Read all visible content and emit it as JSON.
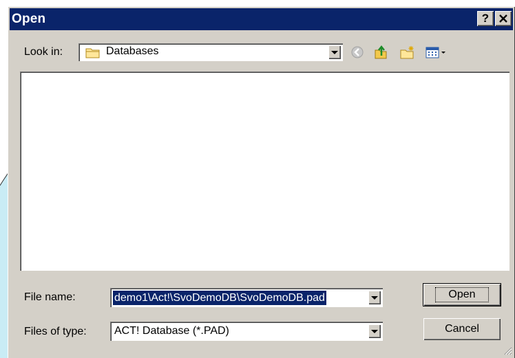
{
  "dialog": {
    "title": "Open",
    "help_button": "?",
    "close_button": "✕"
  },
  "look_in": {
    "label": "Look in:",
    "value": "Databases"
  },
  "toolbar": {
    "icons": [
      "back-icon",
      "up-folder-icon",
      "new-folder-icon",
      "views-menu-icon"
    ]
  },
  "file_name": {
    "label": "File name:",
    "value": "demo1\\Act!\\SvoDemoDB\\SvoDemoDB.pad"
  },
  "files_of_type": {
    "label": "Files of type:",
    "value": "ACT! Database (*.PAD)"
  },
  "buttons": {
    "open": "Open",
    "cancel": "Cancel"
  },
  "colors": {
    "titlebar": "#0a246a",
    "dialog_face": "#d4d0c8",
    "selection": "#0a246a"
  }
}
